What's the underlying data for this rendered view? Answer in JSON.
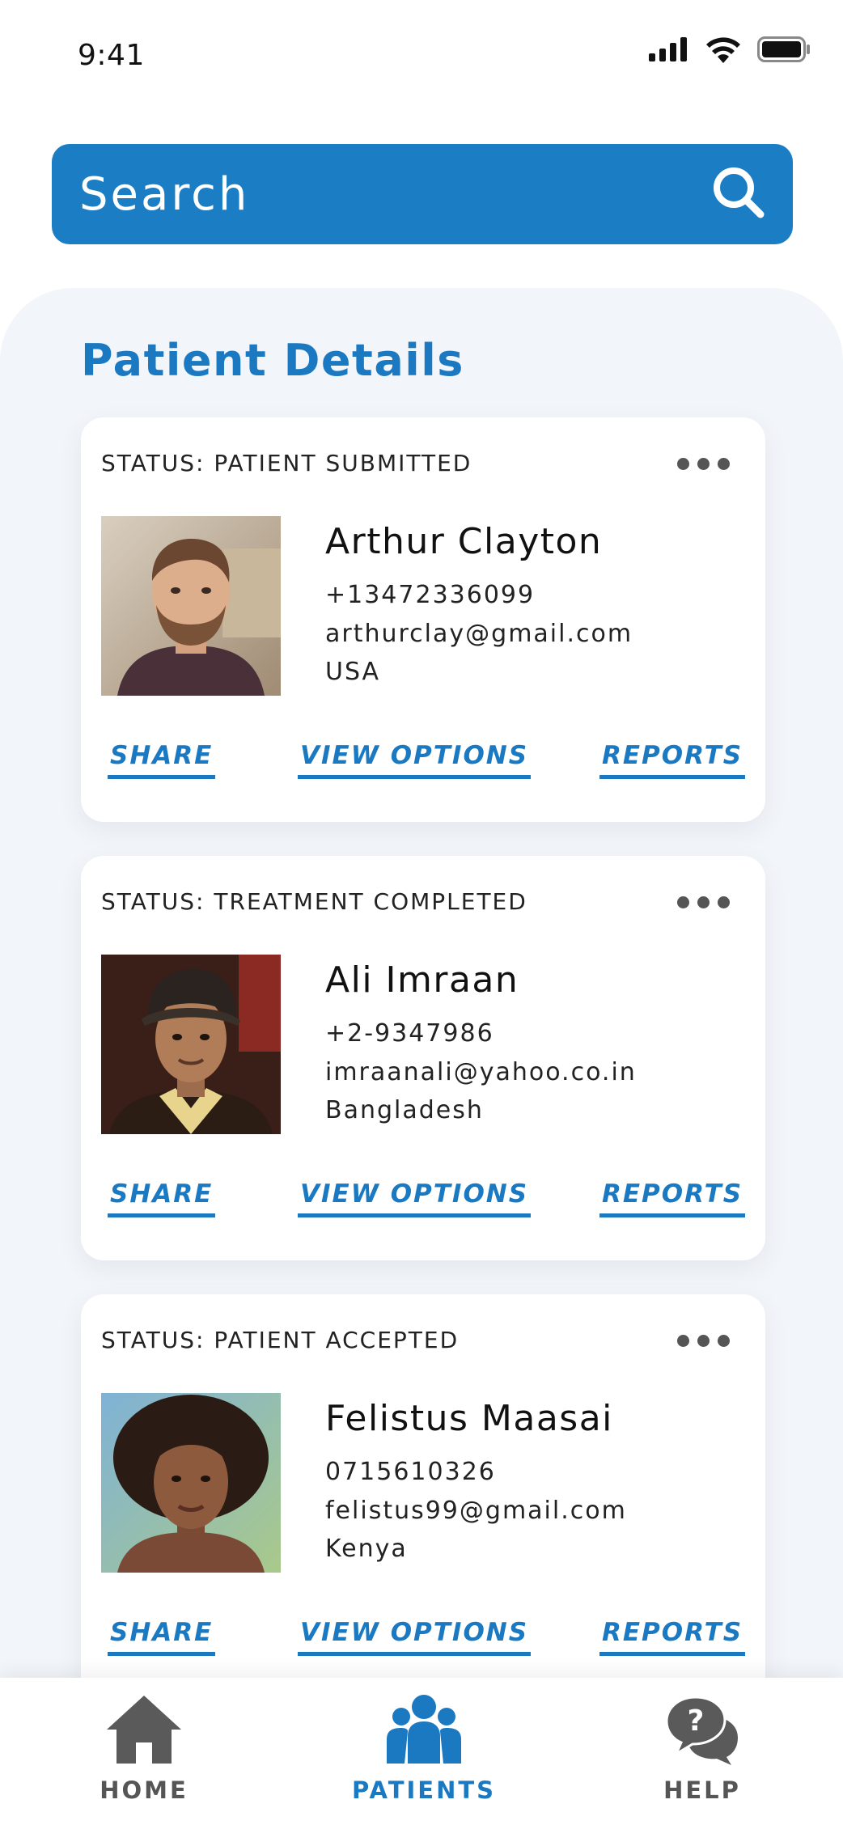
{
  "status_bar": {
    "time": "9:41",
    "icons": [
      "signal-icon",
      "wifi-icon",
      "battery-icon"
    ]
  },
  "search": {
    "placeholder": "Search",
    "value": "",
    "icon": "search-icon"
  },
  "section_title": "Patient Details",
  "colors": {
    "accent": "#1b7ec4",
    "panel_bg": "#f2f5f9",
    "card_bg": "#ffffff",
    "inactive_nav": "#555555"
  },
  "patients": [
    {
      "status": "STATUS: PATIENT SUBMITTED",
      "name": "Arthur Clayton",
      "phone": "+13472336099",
      "email": "arthurclay@gmail.com",
      "country": "USA",
      "actions": {
        "share": "SHARE",
        "view": "VIEW OPTIONS",
        "reports": "REPORTS"
      }
    },
    {
      "status": "STATUS: TREATMENT COMPLETED",
      "name": "Ali Imraan",
      "phone": "+2-9347986",
      "email": "imraanali@yahoo.co.in",
      "country": "Bangladesh",
      "actions": {
        "share": "SHARE",
        "view": "VIEW OPTIONS",
        "reports": "REPORTS"
      }
    },
    {
      "status": "STATUS: PATIENT ACCEPTED",
      "name": "Felistus Maasai",
      "phone": "0715610326",
      "email": "felistus99@gmail.com",
      "country": "Kenya",
      "actions": {
        "share": "SHARE",
        "view": "VIEW OPTIONS",
        "reports": "REPORTS"
      }
    }
  ],
  "nav": {
    "active": "patients",
    "items": [
      {
        "label": "HOME",
        "icon": "home-icon"
      },
      {
        "label": "PATIENTS",
        "icon": "patients-icon"
      },
      {
        "label": "HELP",
        "icon": "help-icon"
      }
    ]
  }
}
